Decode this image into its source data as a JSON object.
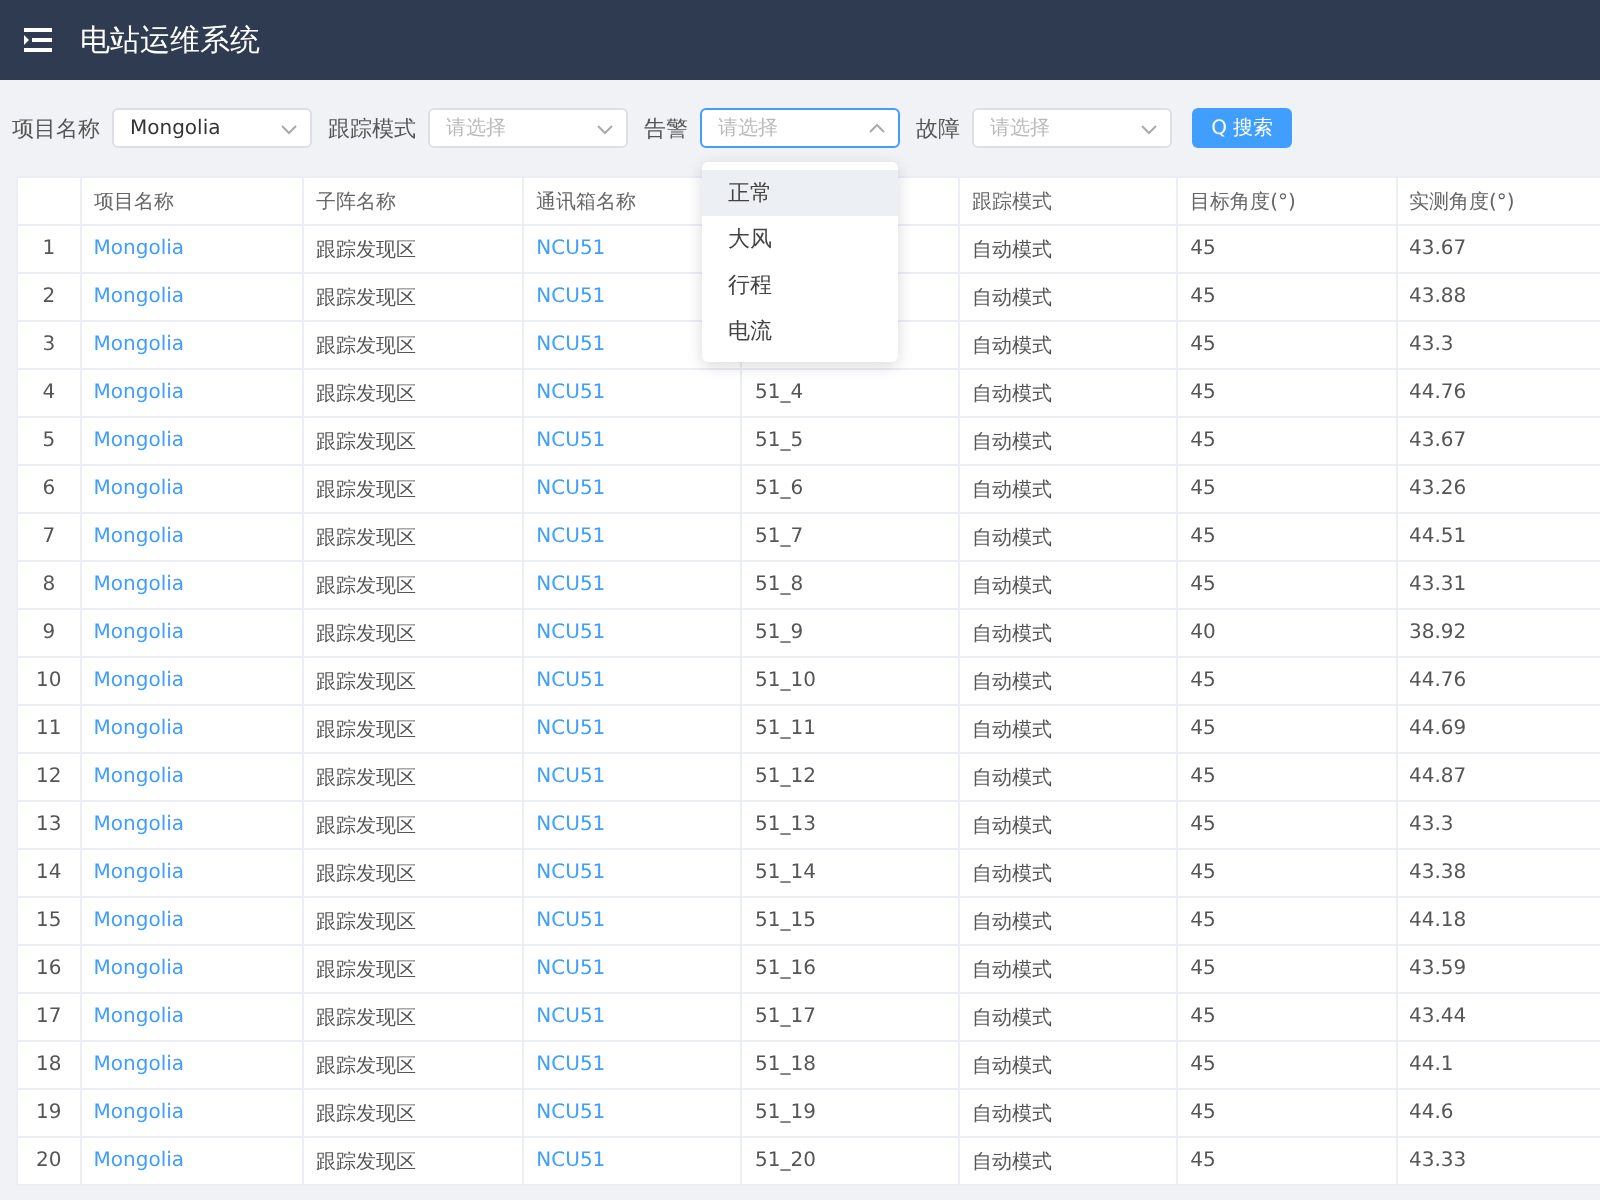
{
  "header": {
    "title": "电站运维系统"
  },
  "filters": [
    {
      "label": "项目名称",
      "value": "Mongolia",
      "open": false
    },
    {
      "label": "跟踪模式",
      "placeholder": "请选择",
      "open": false
    },
    {
      "label": "告警",
      "placeholder": "请选择",
      "open": true,
      "options": [
        {
          "label": "正常",
          "hovered": true
        },
        {
          "label": "大风",
          "hovered": false
        },
        {
          "label": "行程",
          "hovered": false
        },
        {
          "label": "电流",
          "hovered": false
        }
      ]
    },
    {
      "label": "故障",
      "placeholder": "请选择",
      "open": false
    }
  ],
  "search_button": {
    "icon": "Q",
    "label": "搜索"
  },
  "table": {
    "columns": [
      "",
      "项目名称",
      "子阵名称",
      "通讯箱名称",
      null,
      "跟踪模式",
      "目标角度(°)",
      "实测角度(°)"
    ],
    "rows": [
      [
        "1",
        "Mongolia",
        "跟踪发现区",
        "NCU51",
        null,
        "自动模式",
        "45",
        "43.67"
      ],
      [
        "2",
        "Mongolia",
        "跟踪发现区",
        "NCU51",
        null,
        "自动模式",
        "45",
        "43.88"
      ],
      [
        "3",
        "Mongolia",
        "跟踪发现区",
        "NCU51",
        null,
        "自动模式",
        "45",
        "43.3"
      ],
      [
        "4",
        "Mongolia",
        "跟踪发现区",
        "NCU51",
        "51_4",
        "自动模式",
        "45",
        "44.76"
      ],
      [
        "5",
        "Mongolia",
        "跟踪发现区",
        "NCU51",
        "51_5",
        "自动模式",
        "45",
        "43.67"
      ],
      [
        "6",
        "Mongolia",
        "跟踪发现区",
        "NCU51",
        "51_6",
        "自动模式",
        "45",
        "43.26"
      ],
      [
        "7",
        "Mongolia",
        "跟踪发现区",
        "NCU51",
        "51_7",
        "自动模式",
        "45",
        "44.51"
      ],
      [
        "8",
        "Mongolia",
        "跟踪发现区",
        "NCU51",
        "51_8",
        "自动模式",
        "45",
        "43.31"
      ],
      [
        "9",
        "Mongolia",
        "跟踪发现区",
        "NCU51",
        "51_9",
        "自动模式",
        "40",
        "38.92"
      ],
      [
        "10",
        "Mongolia",
        "跟踪发现区",
        "NCU51",
        "51_10",
        "自动模式",
        "45",
        "44.76"
      ],
      [
        "11",
        "Mongolia",
        "跟踪发现区",
        "NCU51",
        "51_11",
        "自动模式",
        "45",
        "44.69"
      ],
      [
        "12",
        "Mongolia",
        "跟踪发现区",
        "NCU51",
        "51_12",
        "自动模式",
        "45",
        "44.87"
      ],
      [
        "13",
        "Mongolia",
        "跟踪发现区",
        "NCU51",
        "51_13",
        "自动模式",
        "45",
        "43.3"
      ],
      [
        "14",
        "Mongolia",
        "跟踪发现区",
        "NCU51",
        "51_14",
        "自动模式",
        "45",
        "43.38"
      ],
      [
        "15",
        "Mongolia",
        "跟踪发现区",
        "NCU51",
        "51_15",
        "自动模式",
        "45",
        "44.18"
      ],
      [
        "16",
        "Mongolia",
        "跟踪发现区",
        "NCU51",
        "51_16",
        "自动模式",
        "45",
        "43.59"
      ],
      [
        "17",
        "Mongolia",
        "跟踪发现区",
        "NCU51",
        "51_17",
        "自动模式",
        "45",
        "43.44"
      ],
      [
        "18",
        "Mongolia",
        "跟踪发现区",
        "NCU51",
        "51_18",
        "自动模式",
        "45",
        "44.1"
      ],
      [
        "19",
        "Mongolia",
        "跟踪发现区",
        "NCU51",
        "51_19",
        "自动模式",
        "45",
        "44.6"
      ],
      [
        "20",
        "Mongolia",
        "跟踪发现区",
        "NCU51",
        "51_20",
        "自动模式",
        "45",
        "43.33"
      ]
    ]
  }
}
